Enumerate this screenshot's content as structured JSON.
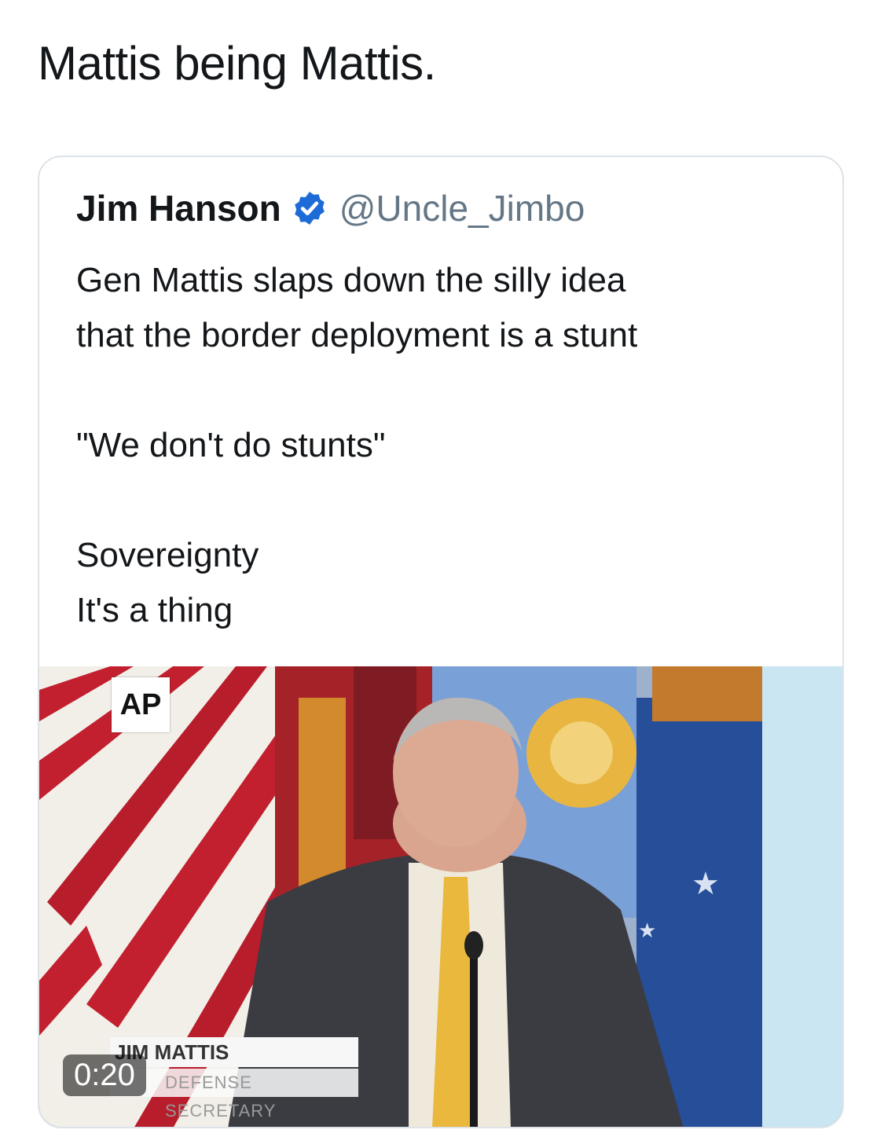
{
  "tweet": {
    "text": "Mattis being Mattis."
  },
  "quoted_tweet": {
    "author_name": "Jim Hanson",
    "verified_icon": "verified-badge-icon",
    "handle": "@Uncle_Jimbo",
    "lines": [
      "Gen Mattis slaps down the silly idea",
      "that the border deployment is a stunt",
      "\"We don't do stunts\"",
      "Sovereignty",
      "It's a thing"
    ]
  },
  "video": {
    "logo": "AP",
    "chyron_name": "JIM MATTIS",
    "chyron_title": "DEFENSE SECRETARY",
    "duration": "0:20"
  },
  "colors": {
    "text": "#14171a",
    "secondary": "#657786",
    "verified": "#1da1f2",
    "border": "#dde3e8"
  }
}
